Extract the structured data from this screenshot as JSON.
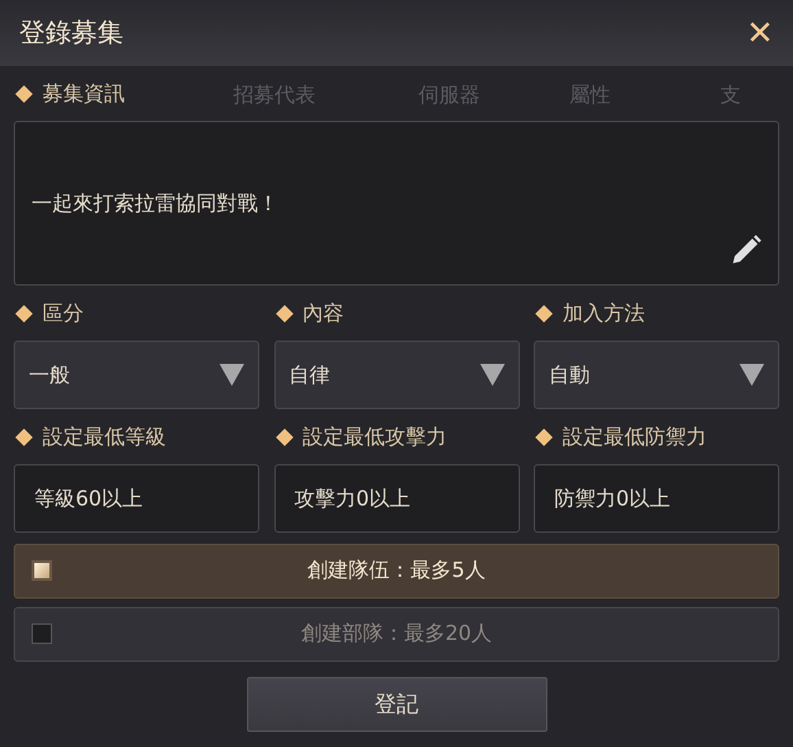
{
  "window": {
    "title": "登錄募集",
    "close": "✕"
  },
  "background_header": [
    "招募代表",
    "伺服器",
    "屬性",
    "支"
  ],
  "info": {
    "heading": "募集資訊",
    "message": "一起來打索拉雷協同對戰！"
  },
  "selects": [
    {
      "label": "區分",
      "value": "一般"
    },
    {
      "label": "內容",
      "value": "自律"
    },
    {
      "label": "加入方法",
      "value": "自動"
    }
  ],
  "minimums": [
    {
      "label": "設定最低等級",
      "value": "等級60以上"
    },
    {
      "label": "設定最低攻擊力",
      "value": "攻擊力0以上"
    },
    {
      "label": "設定最低防禦力",
      "value": "防禦力0以上"
    }
  ],
  "options": [
    {
      "label": "創建隊伍：最多5人",
      "selected": true
    },
    {
      "label": "創建部隊：最多20人",
      "selected": false
    }
  ],
  "submit": "登記"
}
